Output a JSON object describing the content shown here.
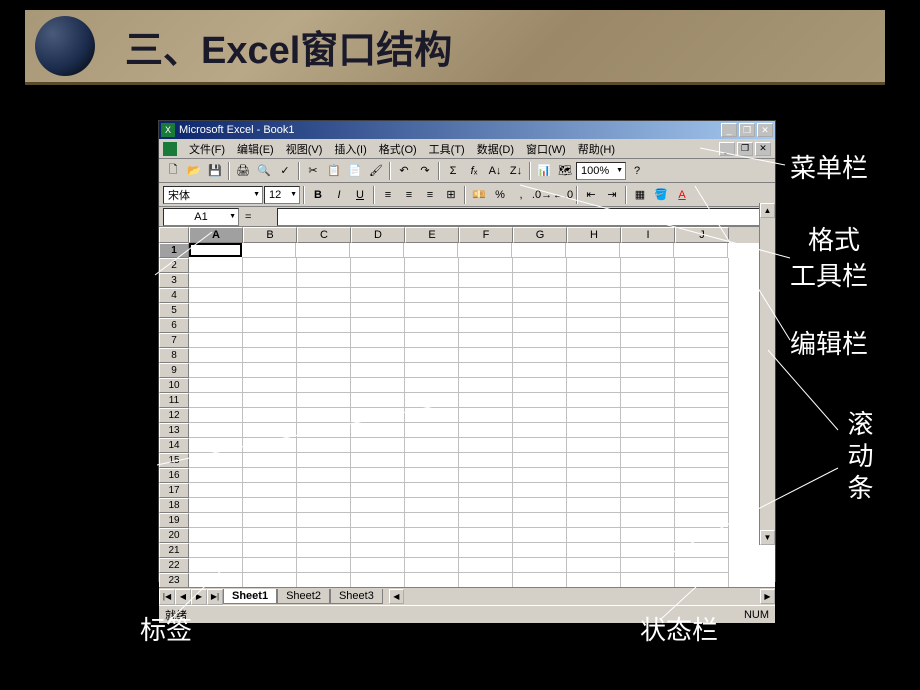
{
  "slide": {
    "title": "三、Excel窗口结构"
  },
  "window": {
    "title": "Microsoft Excel - Book1"
  },
  "menus": {
    "file": "文件(F)",
    "edit": "编辑(E)",
    "view": "视图(V)",
    "insert": "插入(I)",
    "format": "格式(O)",
    "tools": "工具(T)",
    "data": "数据(D)",
    "window": "窗口(W)",
    "help": "帮助(H)"
  },
  "toolbar": {
    "font": "宋体",
    "size": "12",
    "zoom": "100%"
  },
  "namebox": {
    "value": "A1"
  },
  "formulabar": {
    "eq": "="
  },
  "columns": [
    "A",
    "B",
    "C",
    "D",
    "E",
    "F",
    "G",
    "H",
    "I",
    "J"
  ],
  "rows": [
    "1",
    "2",
    "3",
    "4",
    "5",
    "6",
    "7",
    "8",
    "9",
    "10",
    "11",
    "12",
    "13",
    "14",
    "15",
    "16",
    "17",
    "18",
    "19",
    "20",
    "21",
    "22",
    "23"
  ],
  "sheets": {
    "s1": "Sheet1",
    "s2": "Sheet2",
    "s3": "Sheet3"
  },
  "status": {
    "ready": "就绪",
    "num": "NUM"
  },
  "annotations": {
    "menubar": "菜单栏",
    "format_toolbar_l1": "格式",
    "format_toolbar_l2": "工具栏",
    "formula_bar": "编辑栏",
    "scrollbar": "滚动条",
    "statusbar": "状态栏",
    "tabs": "标签"
  }
}
